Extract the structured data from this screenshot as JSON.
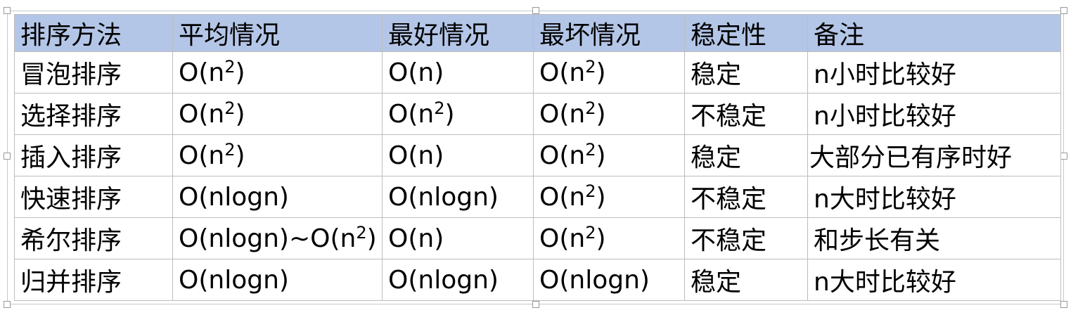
{
  "table": {
    "headers": [
      "排序方法",
      "平均情况",
      "最好情况",
      "最坏情况",
      "稳定性",
      "备注"
    ],
    "rows": [
      [
        {
          "text": "冒泡排序"
        },
        {
          "text": "O(n",
          "sup": "2",
          "after": ")"
        },
        {
          "text": "O(n)"
        },
        {
          "text": "O(n",
          "sup": "2",
          "after": ")"
        },
        {
          "text": "稳定"
        },
        {
          "text": "n小时比较好"
        }
      ],
      [
        {
          "text": "选择排序"
        },
        {
          "text": "O(n",
          "sup": "2",
          "after": ")"
        },
        {
          "text": "O(n",
          "sup": "2",
          "after": ")"
        },
        {
          "text": "O(n",
          "sup": "2",
          "after": ")"
        },
        {
          "text": "不稳定"
        },
        {
          "text": "n小时比较好"
        }
      ],
      [
        {
          "text": "插入排序"
        },
        {
          "text": "O(n",
          "sup": "2",
          "after": ")"
        },
        {
          "text": "O(n)"
        },
        {
          "text": "O(n",
          "sup": "2",
          "after": ")"
        },
        {
          "text": "稳定"
        },
        {
          "text": "大部分已有序时好"
        }
      ],
      [
        {
          "text": "快速排序"
        },
        {
          "text": "O(nlogn)"
        },
        {
          "text": "O(nlogn)"
        },
        {
          "text": "O(n",
          "sup": "2",
          "after": ")"
        },
        {
          "text": "不稳定"
        },
        {
          "text": "n大时比较好"
        }
      ],
      [
        {
          "text": "希尔排序"
        },
        {
          "text": "O(nlogn)~O(n",
          "sup": "2",
          "after": ")"
        },
        {
          "text": "O(n)"
        },
        {
          "text": "O(n",
          "sup": "2",
          "after": ")"
        },
        {
          "text": "不稳定"
        },
        {
          "text": "和步长有关"
        }
      ],
      [
        {
          "text": "归并排序"
        },
        {
          "text": "O(nlogn)"
        },
        {
          "text": "O(nlogn)"
        },
        {
          "text": "O(nlogn)"
        },
        {
          "text": "稳定"
        },
        {
          "text": "n大时比较好"
        }
      ]
    ]
  },
  "colors": {
    "header_bg": "#b4c6e7",
    "border": "#bdbdbd",
    "frame": "#c8c8c8"
  }
}
